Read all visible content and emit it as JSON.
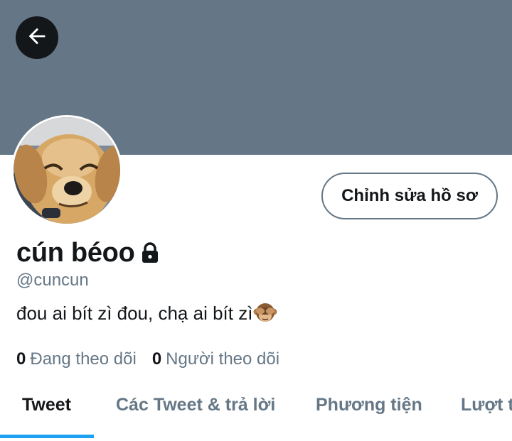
{
  "header": {
    "back_icon": "arrow-left-icon",
    "banner_color": "#657786"
  },
  "profile": {
    "display_name": "cún béoo",
    "protected_icon": "lock-icon",
    "handle": "@cuncun",
    "bio": "đou ai bít zì đou, chạ ai bít zì",
    "bio_emoji": "see-no-evil-monkey-icon",
    "edit_button_label": "Chỉnh sửa hồ sơ",
    "following_count": "0",
    "following_label": "Đang theo dõi",
    "followers_count": "0",
    "followers_label": "Người theo dõi"
  },
  "tabs": [
    {
      "label": "Tweet",
      "active": true
    },
    {
      "label": "Các Tweet & trả lời",
      "active": false
    },
    {
      "label": "Phương tiện",
      "active": false
    },
    {
      "label": "Lượt thích",
      "active": false
    }
  ],
  "colors": {
    "accent": "#1da1f2",
    "text_primary": "#14171a",
    "text_secondary": "#657786"
  }
}
